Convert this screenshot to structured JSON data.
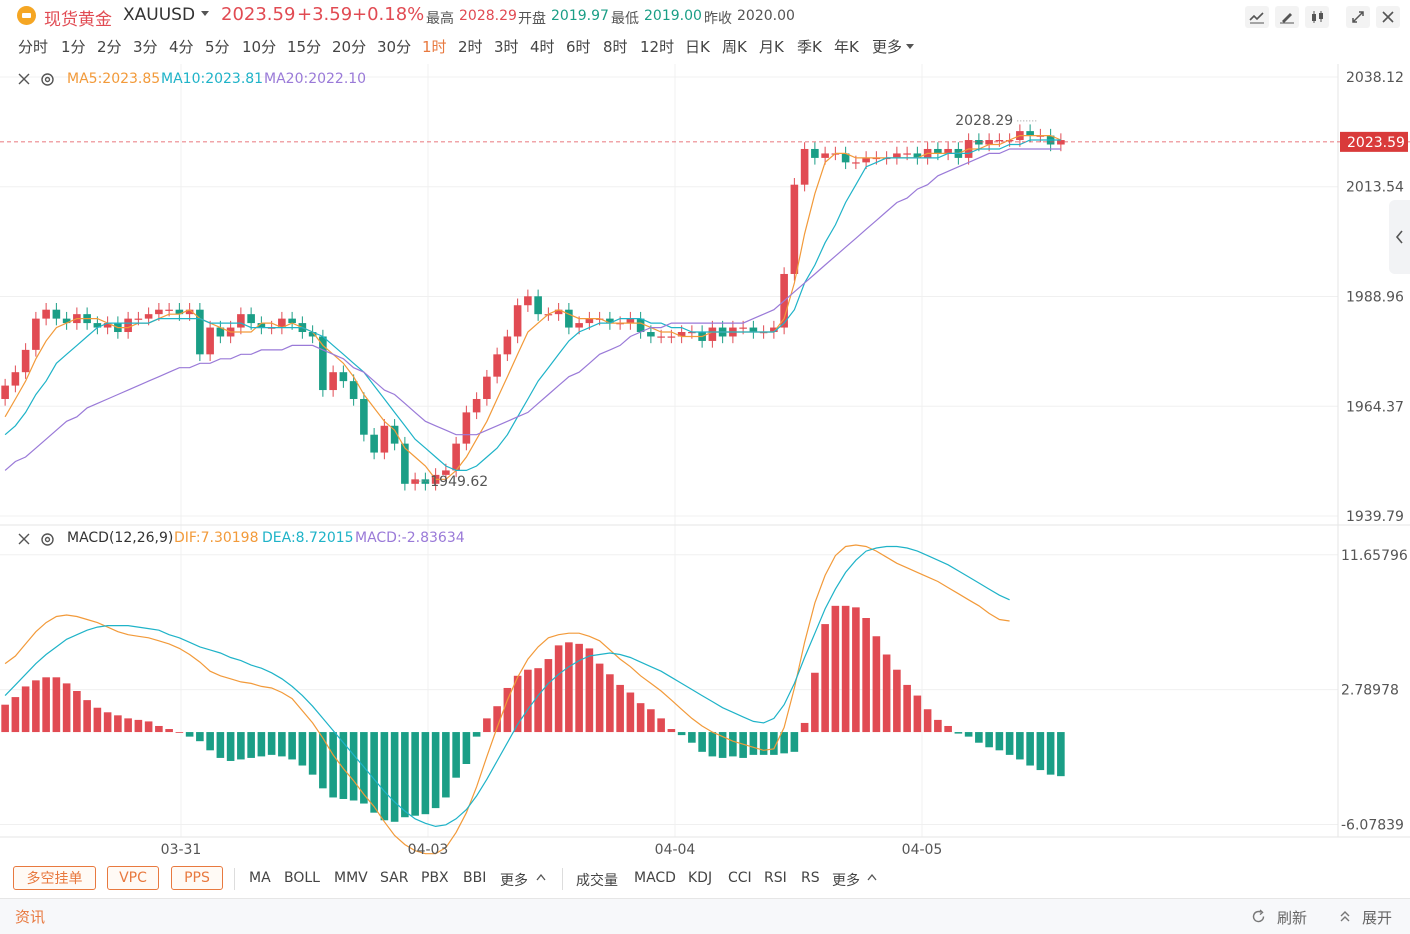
{
  "header": {
    "name": "现货黄金",
    "code": "XAUUSD",
    "price": "2023.59",
    "change": "+3.59",
    "change_pct": "+0.18%",
    "high_label": "最高",
    "high": "2028.29",
    "open_label": "开盘",
    "open": "2019.97",
    "low_label": "最低",
    "low": "2019.00",
    "prev_label": "昨收",
    "prev": "2020.00"
  },
  "timeframes": [
    "分时",
    "1分",
    "2分",
    "3分",
    "4分",
    "5分",
    "10分",
    "15分",
    "20分",
    "30分",
    "1时",
    "2时",
    "3时",
    "4时",
    "6时",
    "8时",
    "12时",
    "日K",
    "周K",
    "月K",
    "季K",
    "年K",
    "更多"
  ],
  "active_timeframe": "1时",
  "main_indicators": {
    "ma5": "MA5:2023.85",
    "ma10": "MA10:2023.81",
    "ma20": "MA20:2022.10"
  },
  "macd_indicators": {
    "name": "MACD(12,26,9)",
    "dif": "DIF:7.30198",
    "dea": "DEA:8.72015",
    "macd": "MACD:-2.83634"
  },
  "colors": {
    "up": "#e14b53",
    "down": "#1a9e86",
    "ma5": "#f29a3a",
    "ma10": "#1fb3c8",
    "ma20": "#9a7ad8",
    "accent": "#e8793f"
  },
  "chart_data": [
    {
      "type": "candlestick",
      "title": "XAUUSD 1时",
      "y_axis_labels": [
        "2038.12",
        "2013.54",
        "1988.96",
        "1964.37",
        "1939.79"
      ],
      "y_axis_values": [
        2038.12,
        2013.54,
        1988.96,
        1964.37,
        1939.79
      ],
      "ylim": [
        1939.79,
        2038.12
      ],
      "current_price_label": "2023.59",
      "max_annotation": "2028.29",
      "min_annotation": "1949.62",
      "x_axis_labels": [
        "03-31",
        "04-03",
        "04-04",
        "04-05"
      ],
      "closes": [
        1969,
        1972,
        1977,
        1984,
        1986,
        1984,
        1983,
        1985,
        1983,
        1982,
        1983,
        1981,
        1984,
        1984,
        1985,
        1986,
        1986,
        1985,
        1986,
        1976,
        1982,
        1980,
        1982,
        1985,
        1983,
        1982,
        1982,
        1984,
        1983,
        1981,
        1980,
        1968,
        1972,
        1970,
        1966,
        1958,
        1954,
        1960,
        1956,
        1947,
        1948,
        1947,
        1949,
        1950,
        1956,
        1963,
        1966,
        1971,
        1976,
        1980,
        1987,
        1989,
        1985,
        1985,
        1986,
        1982,
        1983,
        1984,
        1984,
        1983,
        1983,
        1984,
        1981,
        1980,
        1980,
        1980,
        1981,
        1981,
        1979,
        1982,
        1980,
        1982,
        1982,
        1981,
        1981,
        1982,
        1994,
        2014,
        2022,
        2020,
        2021,
        2021,
        2019,
        2019,
        2020,
        2020,
        2020,
        2021,
        2021,
        2020,
        2022,
        2021,
        2022,
        2020,
        2024,
        2023,
        2024,
        2024,
        2024,
        2026,
        2025,
        2025,
        2023,
        2024
      ],
      "series": [
        {
          "name": "MA5",
          "values": [
            1962,
            1966,
            1970,
            1975,
            1979,
            1982,
            1983,
            1984,
            1984,
            1984,
            1983,
            1982,
            1982,
            1983,
            1983,
            1984,
            1985,
            1985,
            1986,
            1984,
            1983,
            1982,
            1981,
            1981,
            1981,
            1983,
            1983,
            1982,
            1983,
            1982,
            1981,
            1978,
            1976,
            1974,
            1971,
            1967,
            1964,
            1961,
            1959,
            1955,
            1953,
            1951,
            1948,
            1948,
            1950,
            1953,
            1957,
            1961,
            1966,
            1971,
            1976,
            1981,
            1983,
            1985,
            1986,
            1985,
            1984,
            1984,
            1984,
            1983,
            1983,
            1983,
            1983,
            1982,
            1981,
            1981,
            1980,
            1980,
            1980,
            1981,
            1981,
            1981,
            1981,
            1981,
            1981,
            1981,
            1984,
            1992,
            2003,
            2012,
            2019,
            2021,
            2021,
            2020,
            2020,
            2020,
            2020,
            2020,
            2020,
            2020,
            2021,
            2021,
            2021,
            2021,
            2022,
            2022,
            2023,
            2023,
            2024,
            2025,
            2025,
            2025,
            2025,
            2024
          ]
        },
        {
          "name": "MA10",
          "values": [
            1958,
            1960,
            1963,
            1967,
            1970,
            1974,
            1976,
            1978,
            1980,
            1982,
            1983,
            1983,
            1983,
            1983,
            1983,
            1984,
            1984,
            1984,
            1984,
            1984,
            1983,
            1983,
            1983,
            1983,
            1982,
            1982,
            1982,
            1982,
            1982,
            1982,
            1981,
            1980,
            1978,
            1976,
            1974,
            1972,
            1969,
            1966,
            1963,
            1960,
            1957,
            1955,
            1953,
            1951,
            1950,
            1950,
            1951,
            1953,
            1955,
            1958,
            1962,
            1966,
            1970,
            1973,
            1976,
            1979,
            1981,
            1982,
            1983,
            1983,
            1984,
            1984,
            1984,
            1983,
            1983,
            1982,
            1982,
            1981,
            1981,
            1981,
            1981,
            1981,
            1981,
            1981,
            1981,
            1981,
            1983,
            1986,
            1992,
            1996,
            2001,
            2005,
            2010,
            2014,
            2018,
            2019,
            2020,
            2020,
            2020,
            2020,
            2020,
            2020,
            2021,
            2021,
            2021,
            2022,
            2022,
            2022,
            2023,
            2023,
            2024,
            2024,
            2024,
            2024
          ]
        },
        {
          "name": "MA20",
          "values": [
            1950,
            1952,
            1953,
            1955,
            1957,
            1959,
            1961,
            1962,
            1964,
            1965,
            1966,
            1967,
            1968,
            1969,
            1970,
            1971,
            1972,
            1973,
            1973,
            1974,
            1974,
            1975,
            1975,
            1976,
            1976,
            1977,
            1977,
            1977,
            1978,
            1978,
            1978,
            1977,
            1976,
            1975,
            1973,
            1972,
            1970,
            1968,
            1967,
            1965,
            1963,
            1961,
            1960,
            1959,
            1958,
            1958,
            1958,
            1959,
            1960,
            1961,
            1962,
            1963,
            1965,
            1967,
            1969,
            1971,
            1972,
            1974,
            1976,
            1977,
            1978,
            1980,
            1981,
            1982,
            1982,
            1983,
            1983,
            1983,
            1983,
            1983,
            1983,
            1983,
            1983,
            1984,
            1985,
            1986,
            1988,
            1990,
            1992,
            1994,
            1996,
            1998,
            2000,
            2002,
            2004,
            2006,
            2008,
            2010,
            2011,
            2013,
            2014,
            2016,
            2017,
            2018,
            2019,
            2020,
            2021,
            2021,
            2022,
            2022,
            2022,
            2022,
            2022,
            2022
          ]
        }
      ]
    },
    {
      "type": "bar",
      "title": "MACD(12,26,9)",
      "y_axis_labels": [
        "11.65796",
        "2.78978",
        "-6.07839"
      ],
      "y_axis_values": [
        11.65796,
        2.78978,
        -6.07839
      ],
      "ylim": [
        -6.9,
        12.3
      ],
      "values": [
        1.8,
        2.3,
        3.0,
        3.4,
        3.6,
        3.6,
        3.2,
        2.7,
        2.1,
        1.6,
        1.3,
        1.1,
        0.9,
        0.8,
        0.7,
        0.4,
        0.2,
        0.0,
        -0.3,
        -0.6,
        -1.2,
        -1.7,
        -1.9,
        -1.8,
        -1.7,
        -1.6,
        -1.5,
        -1.6,
        -1.8,
        -2.2,
        -2.8,
        -3.7,
        -4.3,
        -4.4,
        -4.5,
        -4.7,
        -5.3,
        -5.8,
        -5.9,
        -5.6,
        -5.5,
        -5.4,
        -5.0,
        -4.3,
        -3.0,
        -2.1,
        -0.3,
        0.9,
        1.7,
        2.9,
        3.7,
        4.1,
        4.2,
        4.8,
        5.7,
        5.9,
        5.8,
        5.5,
        4.5,
        3.8,
        3.1,
        2.6,
        1.9,
        1.5,
        0.9,
        0.2,
        -0.2,
        -0.7,
        -1.3,
        -1.6,
        -1.7,
        -1.6,
        -1.7,
        -1.5,
        -1.5,
        -1.5,
        -1.4,
        -1.3,
        0.6,
        3.9,
        7.1,
        8.3,
        8.3,
        8.2,
        7.5,
        6.3,
        5.1,
        4.1,
        3.1,
        2.4,
        1.5,
        0.8,
        0.4,
        -0.1,
        -0.3,
        -0.7,
        -1.0,
        -1.2,
        -1.5,
        -1.8,
        -2.2,
        -2.5,
        -2.8,
        -2.9
      ],
      "series": [
        {
          "name": "DIF",
          "values": [
            4.5,
            5.0,
            5.8,
            6.6,
            7.2,
            7.6,
            7.7,
            7.6,
            7.4,
            7.2,
            6.9,
            6.6,
            6.4,
            6.3,
            6.2,
            6.0,
            5.8,
            5.5,
            5.1,
            4.6,
            4.0,
            3.7,
            3.5,
            3.3,
            3.2,
            3.0,
            2.9,
            2.6,
            2.2,
            1.4,
            0.6,
            -0.4,
            -1.5,
            -2.4,
            -3.2,
            -4.1,
            -4.9,
            -5.9,
            -6.8,
            -7.4,
            -7.8,
            -8.0,
            -8.0,
            -7.6,
            -6.6,
            -5.3,
            -3.6,
            -1.6,
            0.3,
            2.1,
            3.6,
            4.8,
            5.6,
            6.2,
            6.4,
            6.5,
            6.5,
            6.3,
            6.0,
            5.4,
            4.8,
            4.3,
            3.7,
            3.2,
            2.7,
            2.1,
            1.5,
            0.9,
            0.4,
            0.0,
            -0.3,
            -0.6,
            -0.8,
            -1.0,
            -1.2,
            -1.1,
            0.3,
            2.9,
            5.9,
            8.5,
            10.3,
            11.6,
            12.2,
            12.3,
            12.2,
            11.9,
            11.5,
            11.1,
            10.8,
            10.5,
            10.2,
            9.9,
            9.5,
            9.1,
            8.7,
            8.3,
            7.8,
            7.4,
            7.3
          ]
        },
        {
          "name": "DEA",
          "values": [
            2.4,
            3.1,
            3.8,
            4.5,
            5.1,
            5.6,
            6.1,
            6.4,
            6.7,
            6.9,
            7.0,
            7.0,
            7.0,
            6.9,
            6.8,
            6.7,
            6.4,
            6.2,
            5.9,
            5.6,
            5.4,
            5.2,
            4.9,
            4.7,
            4.4,
            4.2,
            3.9,
            3.5,
            3.0,
            2.4,
            1.7,
            0.9,
            0.1,
            -0.7,
            -1.5,
            -2.3,
            -3.1,
            -3.9,
            -4.6,
            -5.2,
            -5.7,
            -6.0,
            -6.2,
            -6.1,
            -5.7,
            -5.1,
            -4.2,
            -3.1,
            -1.9,
            -0.7,
            0.5,
            1.5,
            2.4,
            3.2,
            3.8,
            4.3,
            4.7,
            5.0,
            5.1,
            5.2,
            5.1,
            4.9,
            4.6,
            4.3,
            4.0,
            3.6,
            3.2,
            2.8,
            2.4,
            2.0,
            1.6,
            1.3,
            1.0,
            0.7,
            0.6,
            0.9,
            1.8,
            3.2,
            4.9,
            6.5,
            8.1,
            9.4,
            10.5,
            11.3,
            11.9,
            12.1,
            12.2,
            12.2,
            12.1,
            11.9,
            11.6,
            11.3,
            11.0,
            10.6,
            10.2,
            9.8,
            9.4,
            9.0,
            8.7
          ]
        }
      ]
    }
  ],
  "bottom_toolbar": {
    "pills": [
      "多空挂单",
      "VPC",
      "PPS"
    ],
    "main_inds": [
      "MA",
      "BOLL",
      "MMV",
      "SAR",
      "PBX",
      "BBI"
    ],
    "more1": "更多",
    "sub_inds": [
      "成交量",
      "MACD",
      "KDJ",
      "CCI",
      "RSI",
      "RS"
    ],
    "more2": "更多"
  },
  "footer": {
    "news": "资讯",
    "refresh": "刷新",
    "expand": "展开"
  }
}
